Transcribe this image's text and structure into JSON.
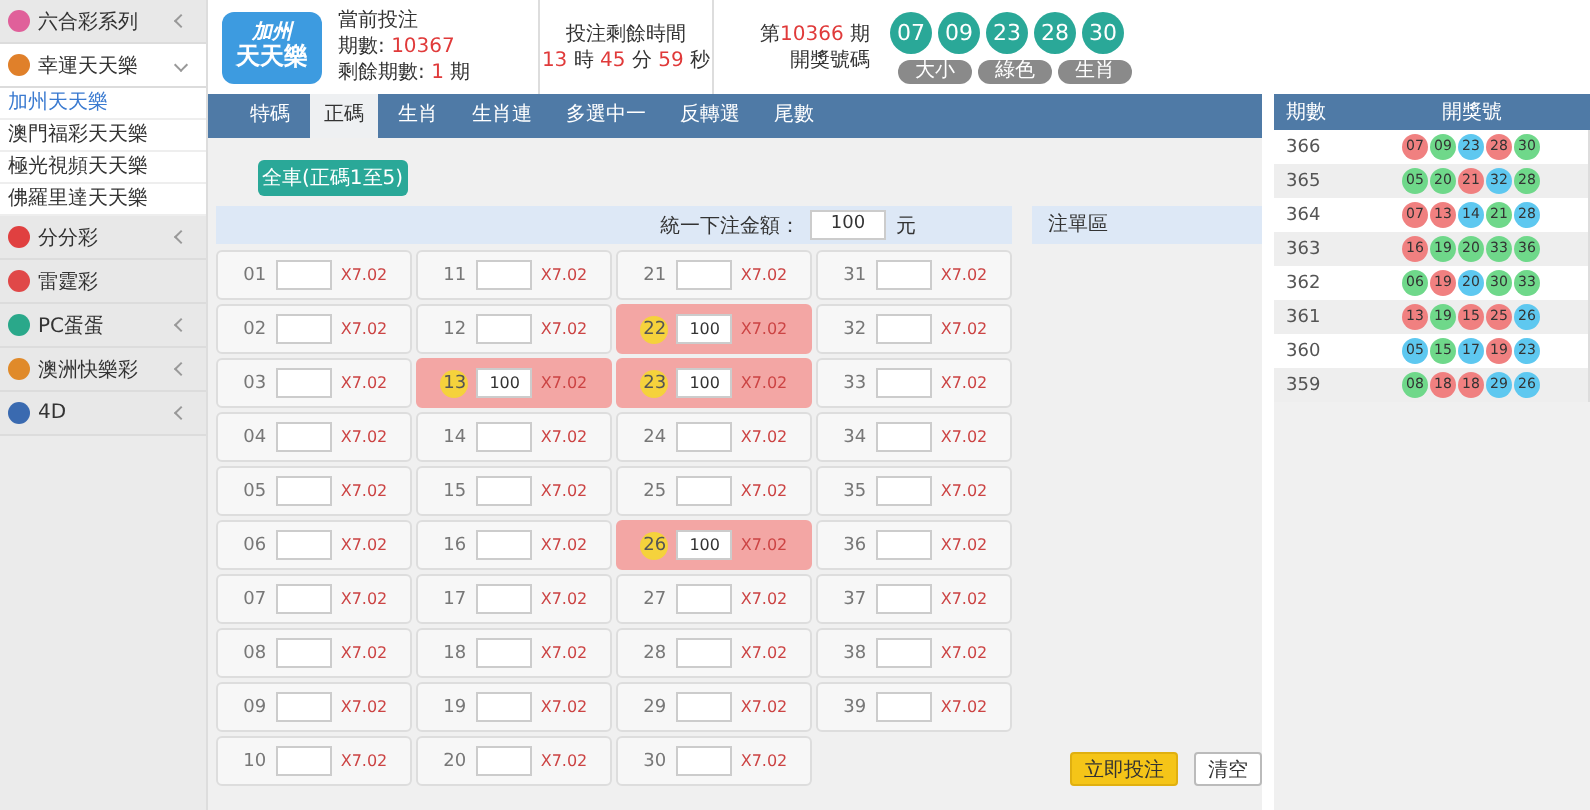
{
  "sidebar": {
    "items": [
      {
        "label": "六合彩系列",
        "kind": "group",
        "expanded": false,
        "color": "#e0609a"
      },
      {
        "label": "幸運天天樂",
        "kind": "group",
        "expanded": true,
        "color": "#e0802a",
        "children": [
          {
            "label": "加州天天樂",
            "selected": true
          },
          {
            "label": "澳門福彩天天樂",
            "selected": false
          },
          {
            "label": "極光視頻天天樂",
            "selected": false
          },
          {
            "label": "佛羅里達天天樂",
            "selected": false
          }
        ]
      },
      {
        "label": "分分彩",
        "kind": "group",
        "expanded": false,
        "color": "#e04040"
      },
      {
        "label": "雷霆彩",
        "kind": "link",
        "color": "#e04848"
      },
      {
        "label": "PC蛋蛋",
        "kind": "group",
        "expanded": false,
        "color": "#2aa88a"
      },
      {
        "label": "澳洲快樂彩",
        "kind": "group",
        "expanded": false,
        "color": "#e08a2a"
      },
      {
        "label": "4D",
        "kind": "group",
        "expanded": false,
        "color": "#3a6ab0"
      }
    ]
  },
  "header": {
    "logo_top": "加州",
    "logo_bottom": "天天樂",
    "current_label": "當前投注",
    "period_label": "期數: ",
    "period": "10367",
    "remaining_label": "剩餘期數: ",
    "remaining": "1",
    "remaining_unit": " 期",
    "countdown_label": "投注剩餘時間",
    "countdown": [
      {
        "value": "13",
        "unit": " 時 "
      },
      {
        "value": "45",
        "unit": " 分 "
      },
      {
        "value": "59",
        "unit": " 秒"
      }
    ],
    "draw_prefix": "第",
    "draw_period": "10366",
    "draw_suffix": " 期",
    "draw_label": "開獎號碼",
    "balls": [
      "07",
      "09",
      "23",
      "28",
      "30"
    ],
    "tags": [
      "大小",
      "綠色",
      "生肖"
    ]
  },
  "tabs": [
    {
      "label": "特碼",
      "selected": false
    },
    {
      "label": "正碼",
      "selected": true
    },
    {
      "label": "生肖",
      "selected": false
    },
    {
      "label": "生肖連",
      "selected": false
    },
    {
      "label": "多選中一",
      "selected": false
    },
    {
      "label": "反轉選",
      "selected": false
    },
    {
      "label": "尾數",
      "selected": false
    }
  ],
  "mode_button": "全車(正碼1至5)",
  "unified_amount": {
    "label": "統一下注金額：",
    "value": "100",
    "unit": "元"
  },
  "slip_title": "注單區",
  "grid": [
    [
      {
        "number": "01",
        "odds": "X7.02",
        "selected": false
      },
      {
        "number": "02",
        "odds": "X7.02",
        "selected": false
      },
      {
        "number": "03",
        "odds": "X7.02",
        "selected": false
      },
      {
        "number": "04",
        "odds": "X7.02",
        "selected": false
      },
      {
        "number": "05",
        "odds": "X7.02",
        "selected": false
      },
      {
        "number": "06",
        "odds": "X7.02",
        "selected": false
      },
      {
        "number": "07",
        "odds": "X7.02",
        "selected": false
      },
      {
        "number": "08",
        "odds": "X7.02",
        "selected": false
      },
      {
        "number": "09",
        "odds": "X7.02",
        "selected": false
      },
      {
        "number": "10",
        "odds": "X7.02",
        "selected": false
      }
    ],
    [
      {
        "number": "11",
        "odds": "X7.02",
        "selected": false
      },
      {
        "number": "12",
        "odds": "X7.02",
        "selected": false
      },
      {
        "number": "13",
        "amount": "100",
        "odds": "X7.02",
        "selected": true
      },
      {
        "number": "14",
        "odds": "X7.02",
        "selected": false
      },
      {
        "number": "15",
        "odds": "X7.02",
        "selected": false
      },
      {
        "number": "16",
        "odds": "X7.02",
        "selected": false
      },
      {
        "number": "17",
        "odds": "X7.02",
        "selected": false
      },
      {
        "number": "18",
        "odds": "X7.02",
        "selected": false
      },
      {
        "number": "19",
        "odds": "X7.02",
        "selected": false
      },
      {
        "number": "20",
        "odds": "X7.02",
        "selected": false
      }
    ],
    [
      {
        "number": "21",
        "odds": "X7.02",
        "selected": false
      },
      {
        "number": "22",
        "amount": "100",
        "odds": "X7.02",
        "selected": true
      },
      {
        "number": "23",
        "amount": "100",
        "odds": "X7.02",
        "selected": true
      },
      {
        "number": "24",
        "odds": "X7.02",
        "selected": false
      },
      {
        "number": "25",
        "odds": "X7.02",
        "selected": false
      },
      {
        "number": "26",
        "amount": "100",
        "odds": "X7.02",
        "selected": true
      },
      {
        "number": "27",
        "odds": "X7.02",
        "selected": false
      },
      {
        "number": "28",
        "odds": "X7.02",
        "selected": false
      },
      {
        "number": "29",
        "odds": "X7.02",
        "selected": false
      },
      {
        "number": "30",
        "odds": "X7.02",
        "selected": false
      }
    ],
    [
      {
        "number": "31",
        "odds": "X7.02",
        "selected": false
      },
      {
        "number": "32",
        "odds": "X7.02",
        "selected": false
      },
      {
        "number": "33",
        "odds": "X7.02",
        "selected": false
      },
      {
        "number": "34",
        "odds": "X7.02",
        "selected": false
      },
      {
        "number": "35",
        "odds": "X7.02",
        "selected": false
      },
      {
        "number": "36",
        "odds": "X7.02",
        "selected": false
      },
      {
        "number": "37",
        "odds": "X7.02",
        "selected": false
      },
      {
        "number": "38",
        "odds": "X7.02",
        "selected": false
      },
      {
        "number": "39",
        "odds": "X7.02",
        "selected": false
      }
    ]
  ],
  "actions": [
    {
      "label": "立即投注",
      "kind": "primary"
    },
    {
      "label": "清空",
      "kind": "secondary"
    }
  ],
  "history": {
    "columns": [
      "期數",
      "開獎號"
    ],
    "rows": [
      {
        "period": "366",
        "balls": [
          {
            "number": "07",
            "color": "#f08080"
          },
          {
            "number": "09",
            "color": "#6fd88a"
          },
          {
            "number": "23",
            "color": "#5ec8f0"
          },
          {
            "number": "28",
            "color": "#f08080"
          },
          {
            "number": "30",
            "color": "#6fd88a"
          }
        ]
      },
      {
        "period": "365",
        "balls": [
          {
            "number": "05",
            "color": "#6fd88a"
          },
          {
            "number": "20",
            "color": "#6fd88a"
          },
          {
            "number": "21",
            "color": "#f08080"
          },
          {
            "number": "32",
            "color": "#5ec8f0"
          },
          {
            "number": "28",
            "color": "#6fd88a"
          }
        ]
      },
      {
        "period": "364",
        "balls": [
          {
            "number": "07",
            "color": "#f08080"
          },
          {
            "number": "13",
            "color": "#f08080"
          },
          {
            "number": "14",
            "color": "#5ec8f0"
          },
          {
            "number": "21",
            "color": "#6fd88a"
          },
          {
            "number": "28",
            "color": "#5ec8f0"
          }
        ]
      },
      {
        "period": "363",
        "balls": [
          {
            "number": "16",
            "color": "#f08080"
          },
          {
            "number": "19",
            "color": "#6fd88a"
          },
          {
            "number": "20",
            "color": "#6fd88a"
          },
          {
            "number": "33",
            "color": "#6fd88a"
          },
          {
            "number": "36",
            "color": "#6fd88a"
          }
        ]
      },
      {
        "period": "362",
        "balls": [
          {
            "number": "06",
            "color": "#6fd88a"
          },
          {
            "number": "19",
            "color": "#f08080"
          },
          {
            "number": "20",
            "color": "#5ec8f0"
          },
          {
            "number": "30",
            "color": "#6fd88a"
          },
          {
            "number": "33",
            "color": "#6fd88a"
          }
        ]
      },
      {
        "period": "361",
        "balls": [
          {
            "number": "13",
            "color": "#f08080"
          },
          {
            "number": "19",
            "color": "#6fd88a"
          },
          {
            "number": "15",
            "color": "#f08080"
          },
          {
            "number": "25",
            "color": "#f08080"
          },
          {
            "number": "26",
            "color": "#5ec8f0"
          }
        ]
      },
      {
        "period": "360",
        "balls": [
          {
            "number": "05",
            "color": "#5ec8f0"
          },
          {
            "number": "15",
            "color": "#6fd88a"
          },
          {
            "number": "17",
            "color": "#5ec8f0"
          },
          {
            "number": "19",
            "color": "#f08080"
          },
          {
            "number": "23",
            "color": "#5ec8f0"
          }
        ]
      },
      {
        "period": "359",
        "balls": [
          {
            "number": "08",
            "color": "#6fd88a"
          },
          {
            "number": "18",
            "color": "#f08080"
          },
          {
            "number": "18",
            "color": "#f08080"
          },
          {
            "number": "29",
            "color": "#5ec8f0"
          },
          {
            "number": "26",
            "color": "#5ec8f0"
          }
        ]
      }
    ]
  }
}
